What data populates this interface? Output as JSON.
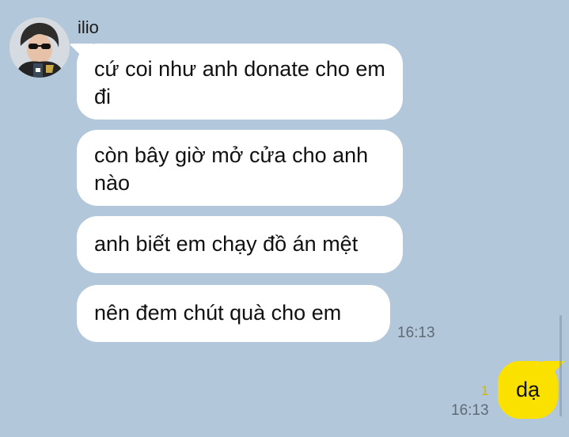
{
  "chat": {
    "sender": {
      "name": "ilio",
      "avatar_icon": "profile-photo"
    },
    "incoming": [
      {
        "text": "cứ coi như anh donate cho em đi"
      },
      {
        "text": "còn bây giờ mở cửa cho anh nào"
      },
      {
        "text": "anh biết em chạy đồ án mệt"
      },
      {
        "text": "nên đem chút quà cho em"
      }
    ],
    "incoming_time": "16:13",
    "outgoing": {
      "text": "dạ",
      "unread_count": "1",
      "time": "16:13"
    }
  },
  "colors": {
    "background": "#b2c7da",
    "incoming_bubble": "#ffffff",
    "outgoing_bubble": "#fae100",
    "unread": "#d4b800",
    "timestamp": "#5e6b77"
  }
}
